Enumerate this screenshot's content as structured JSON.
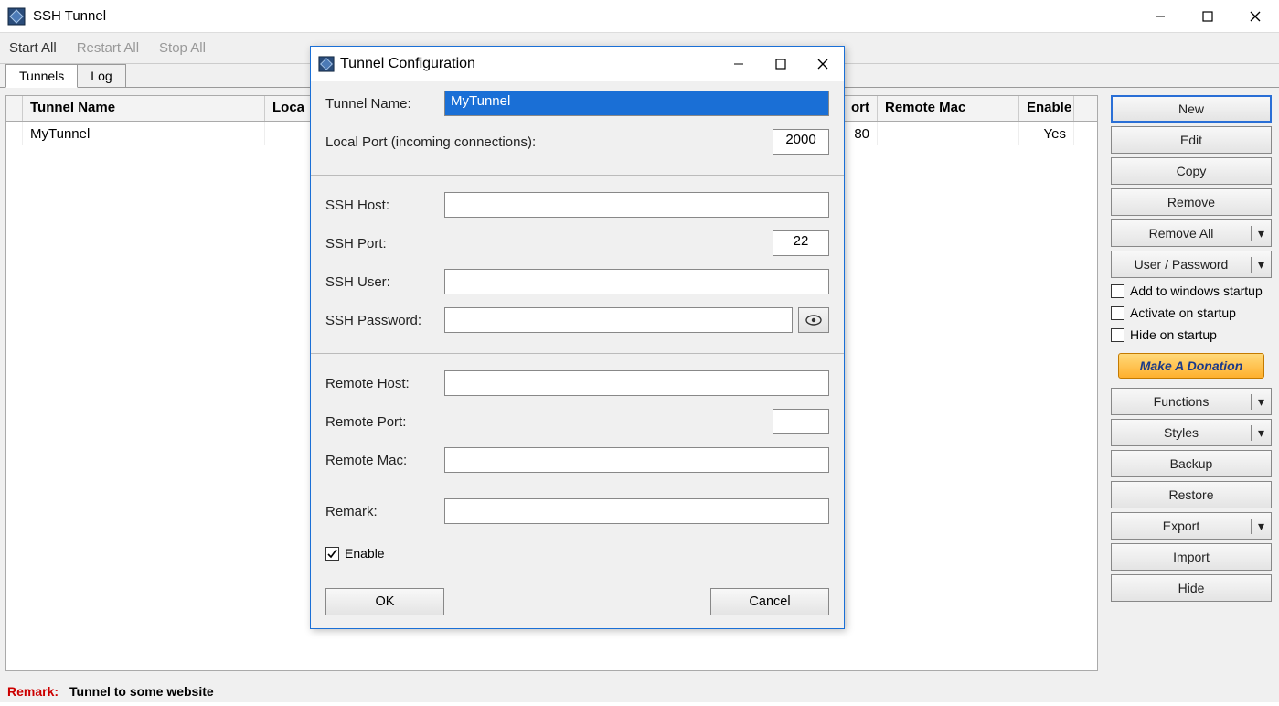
{
  "window": {
    "title": "SSH Tunnel"
  },
  "toolbar": {
    "start_all": "Start All",
    "restart_all": "Restart All",
    "stop_all": "Stop All"
  },
  "tabs": {
    "tunnels": "Tunnels",
    "log": "Log"
  },
  "table": {
    "headers": {
      "name": "Tunnel Name",
      "local": "Loca",
      "rport": "ort",
      "rmac": "Remote Mac",
      "enable": "Enable"
    },
    "rows": [
      {
        "name": "MyTunnel",
        "rport": "80",
        "rmac": "",
        "enable": "Yes"
      }
    ]
  },
  "side": {
    "new": "New",
    "edit": "Edit",
    "copy": "Copy",
    "remove": "Remove",
    "remove_all": "Remove All",
    "user_pass": "User / Password",
    "chk_startup": "Add to windows startup",
    "chk_activate": "Activate on startup",
    "chk_hide": "Hide on startup",
    "donate": "Make A Donation",
    "functions": "Functions",
    "styles": "Styles",
    "backup": "Backup",
    "restore": "Restore",
    "export": "Export",
    "import": "Import",
    "hide": "Hide"
  },
  "status": {
    "remark_label": "Remark:",
    "remark_value": "Tunnel to some website"
  },
  "dialog": {
    "title": "Tunnel Configuration",
    "labels": {
      "tunnel_name": "Tunnel Name:",
      "local_port": "Local Port (incoming connections):",
      "ssh_host": "SSH Host:",
      "ssh_port": "SSH Port:",
      "ssh_user": "SSH User:",
      "ssh_password": "SSH Password:",
      "remote_host": "Remote Host:",
      "remote_port": "Remote Port:",
      "remote_mac": "Remote Mac:",
      "remark": "Remark:",
      "enable": "Enable"
    },
    "values": {
      "tunnel_name": "MyTunnel",
      "local_port": "2000",
      "ssh_host": "",
      "ssh_port": "22",
      "ssh_user": "",
      "ssh_password": "",
      "remote_host": "",
      "remote_port": "",
      "remote_mac": "",
      "remark": "",
      "enable_checked": true
    },
    "buttons": {
      "ok": "OK",
      "cancel": "Cancel"
    }
  }
}
